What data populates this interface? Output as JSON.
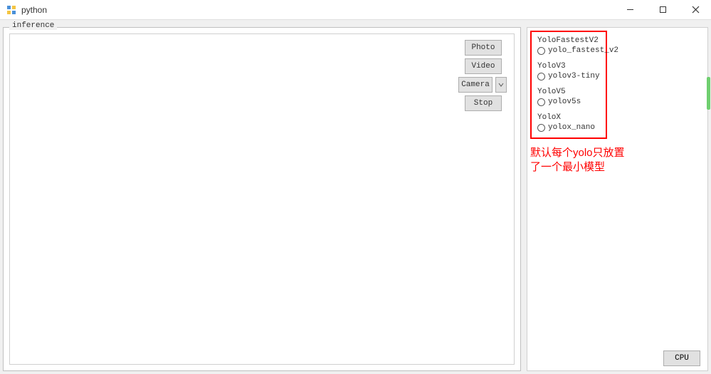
{
  "titlebar": {
    "title": "python"
  },
  "groupbox": {
    "label": "inference"
  },
  "buttons": {
    "photo": "Photo",
    "video": "Video",
    "camera": "Camera",
    "stop": "Stop"
  },
  "models": {
    "groups": [
      {
        "title": "YoloFastestV2",
        "option": "yolo_fastest_v2"
      },
      {
        "title": "YoloV3",
        "option": "yolov3-tiny"
      },
      {
        "title": "YoloV5",
        "option": "yolov5s"
      },
      {
        "title": "YoloX",
        "option": "yolox_nano"
      }
    ]
  },
  "annotation": {
    "line1": "默认每个yolo只放置",
    "line2": "了一个最小模型"
  },
  "cpu_button": "CPU"
}
